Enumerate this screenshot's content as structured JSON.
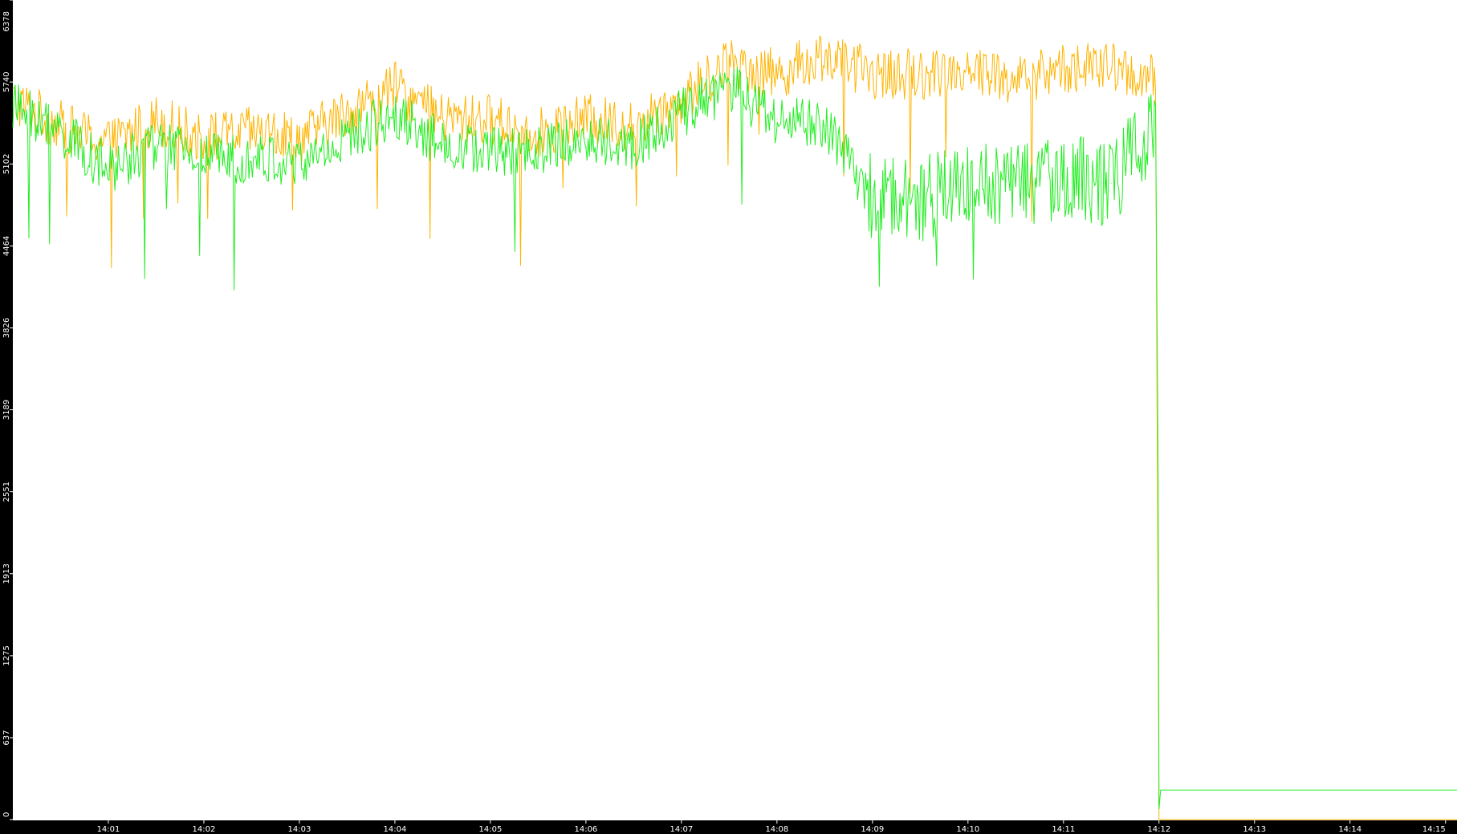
{
  "chart_data": {
    "type": "line",
    "title": "",
    "xlabel": "",
    "ylabel": "",
    "ylim": [
      0,
      6378
    ],
    "xlim": [
      "14:00",
      "14:15"
    ],
    "grid": false,
    "legend": "none",
    "y_ticks": [
      "0",
      "637",
      "1275",
      "1913",
      "2551",
      "3189",
      "3826",
      "4464",
      "5102",
      "5740",
      "6378"
    ],
    "x_ticks": [
      "14:01",
      "14:02",
      "14:03",
      "14:04",
      "14:05",
      "14:06",
      "14:07",
      "14:08",
      "14:09",
      "14:10",
      "14:11",
      "14:12",
      "14:13",
      "14:14",
      "14:15"
    ],
    "colors": {
      "axis_background": "#000000",
      "axis_text": "#ffffff",
      "plot_background": "#ffffff"
    },
    "series": [
      {
        "color": "#ffb400",
        "x": [
          "14:00",
          "14:00:30",
          "14:01",
          "14:01:30",
          "14:02",
          "14:02:30",
          "14:03",
          "14:03:30",
          "14:04",
          "14:04:30",
          "14:05",
          "14:05:30",
          "14:06",
          "14:06:30",
          "14:07",
          "14:07:30",
          "14:08",
          "14:08:30",
          "14:09",
          "14:09:30",
          "14:10",
          "14:10:30",
          "14:11",
          "14:11:30",
          "14:11:58",
          "14:12",
          "14:13",
          "14:14",
          "14:15"
        ],
        "values": [
          5600,
          5400,
          5250,
          5450,
          5300,
          5350,
          5300,
          5500,
          5700,
          5450,
          5450,
          5350,
          5450,
          5400,
          5600,
          5900,
          5800,
          5950,
          5800,
          5800,
          5850,
          5750,
          5850,
          5850,
          5750,
          0,
          0,
          0,
          0
        ]
      },
      {
        "color": "#22ee22",
        "x": [
          "14:00",
          "14:00:30",
          "14:01",
          "14:01:30",
          "14:02",
          "14:02:30",
          "14:03",
          "14:03:30",
          "14:04",
          "14:04:30",
          "14:05",
          "14:05:30",
          "14:06",
          "14:06:30",
          "14:07",
          "14:07:30",
          "14:08",
          "14:08:30",
          "14:09",
          "14:09:30",
          "14:10",
          "14:10:30",
          "14:11",
          "14:11:30",
          "14:11:58",
          "14:12",
          "14:13",
          "14:14",
          "14:15"
        ],
        "values": [
          5550,
          5350,
          5050,
          5250,
          5150,
          5150,
          5100,
          5300,
          5500,
          5250,
          5200,
          5200,
          5300,
          5250,
          5500,
          5700,
          5450,
          5400,
          4850,
          4800,
          5000,
          4950,
          5000,
          4950,
          5400,
          230,
          230,
          230,
          230
        ]
      }
    ]
  }
}
